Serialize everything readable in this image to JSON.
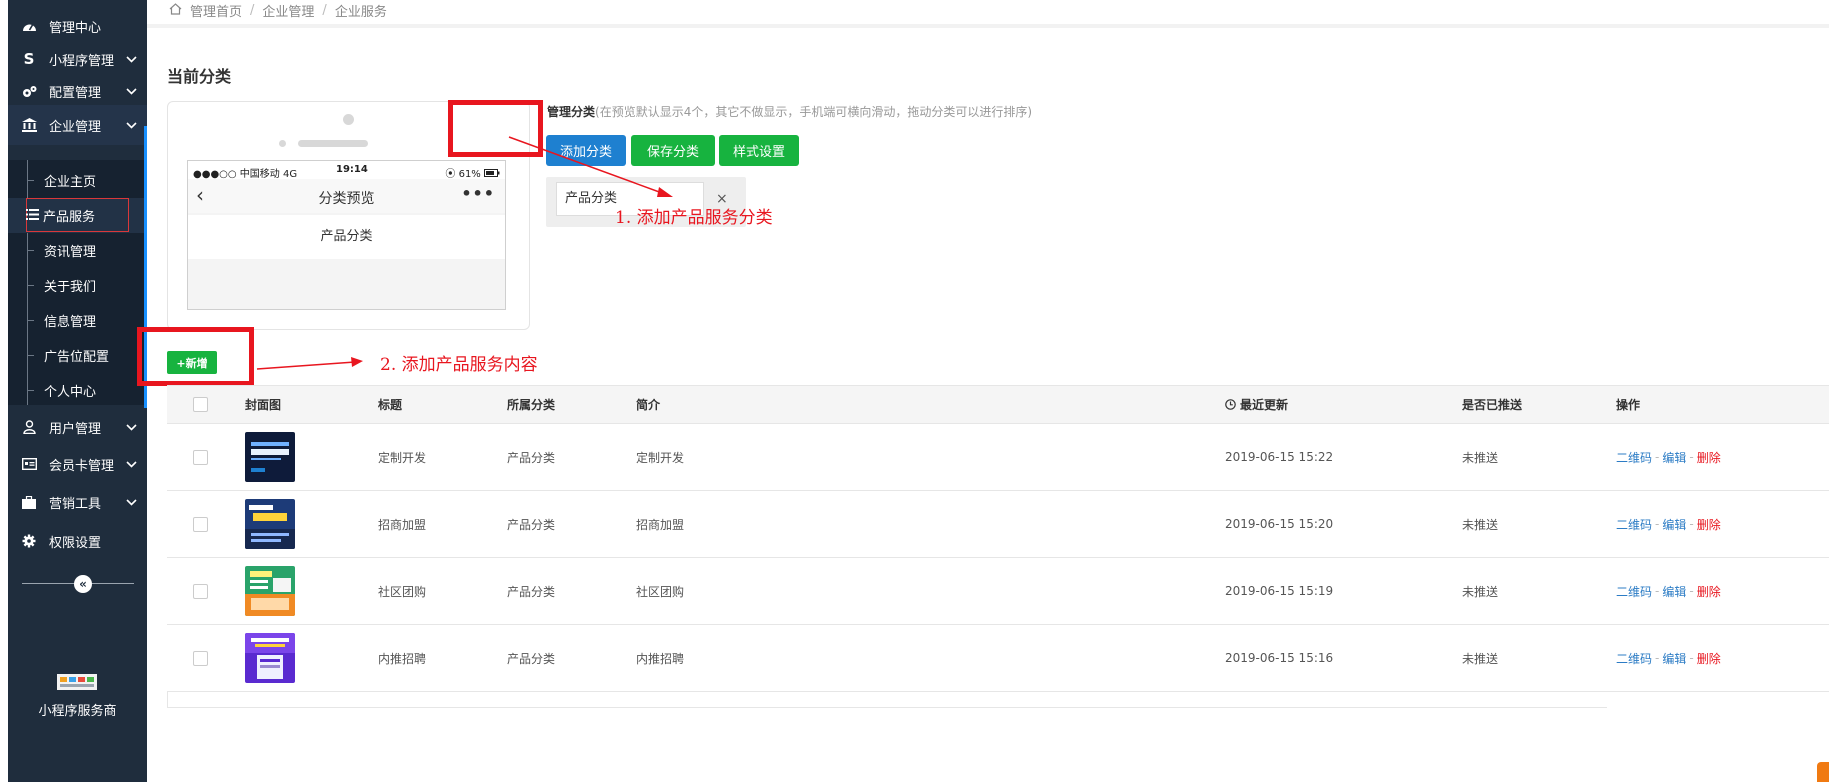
{
  "sidebar": {
    "items": [
      {
        "label": "管理中心",
        "icon": "dashboard-icon",
        "chevron": false
      },
      {
        "label": "小程序管理",
        "icon": "s-logo-icon",
        "chevron": true
      },
      {
        "label": "配置管理",
        "icon": "gears-icon",
        "chevron": true
      },
      {
        "label": "企业管理",
        "icon": "bank-icon",
        "chevron": true
      },
      {
        "label": "用户管理",
        "icon": "user-icon",
        "chevron": true
      },
      {
        "label": "会员卡管理",
        "icon": "card-icon",
        "chevron": true
      },
      {
        "label": "营销工具",
        "icon": "briefcase-icon",
        "chevron": true
      },
      {
        "label": "权限设置",
        "icon": "gear-icon",
        "chevron": false
      }
    ],
    "sub_items": [
      {
        "label": "企业主页"
      },
      {
        "label": "产品服务"
      },
      {
        "label": "资讯管理"
      },
      {
        "label": "关于我们"
      },
      {
        "label": "信息管理"
      },
      {
        "label": "广告位配置"
      },
      {
        "label": "个人中心"
      }
    ],
    "collapse_glyph": "«",
    "brand_name": "小程序服务商"
  },
  "breadcrumb": {
    "items": [
      "管理首页",
      "企业管理",
      "企业服务"
    ],
    "separator": "/"
  },
  "section_title": "当前分类",
  "phone_preview": {
    "carrier": "●●●○○ 中国移动  4G",
    "time": "19:14",
    "battery": "⦿ 61%",
    "nav_title": "分类预览",
    "back_glyph": "‹",
    "more_glyph": "•••",
    "category": "产品分类"
  },
  "category_manager": {
    "label": "管理分类",
    "hint": "(在预览默认显示4个，其它不做显示，手机端可横向滑动，拖动分类可以进行排序)",
    "buttons": {
      "add": "添加分类",
      "save": "保存分类",
      "style": "样式设置"
    },
    "input_value": "产品分类",
    "close_glyph": "×"
  },
  "annotations": {
    "step1": "1.  添加产品服务分类",
    "step2": "2.  添加产品服务内容",
    "color": "#e8161f"
  },
  "add_button": "+新增",
  "table": {
    "headers": [
      "封面图",
      "标题",
      "所属分类",
      "简介",
      "最近更新",
      "是否已推送",
      "操作"
    ],
    "rows": [
      {
        "title": "定制开发",
        "category": "产品分类",
        "intro": "定制开发",
        "updated": "2019-06-15 15:22",
        "pushed": "未推送"
      },
      {
        "title": "招商加盟",
        "category": "产品分类",
        "intro": "招商加盟",
        "updated": "2019-06-15 15:20",
        "pushed": "未推送"
      },
      {
        "title": "社区团购",
        "category": "产品分类",
        "intro": "社区团购",
        "updated": "2019-06-15 15:19",
        "pushed": "未推送"
      },
      {
        "title": "内推招聘",
        "category": "产品分类",
        "intro": "内推招聘",
        "updated": "2019-06-15 15:16",
        "pushed": "未推送"
      }
    ],
    "ops": {
      "qrcode": "二维码",
      "edit": "编辑",
      "delete": "删除",
      "sep": "-"
    }
  },
  "colors": {
    "sidebar_bg": "#1f2d3d",
    "primary_blue": "#1e80d0",
    "green": "#17b33f",
    "link": "#2c7cc5",
    "danger": "#e8161f"
  }
}
